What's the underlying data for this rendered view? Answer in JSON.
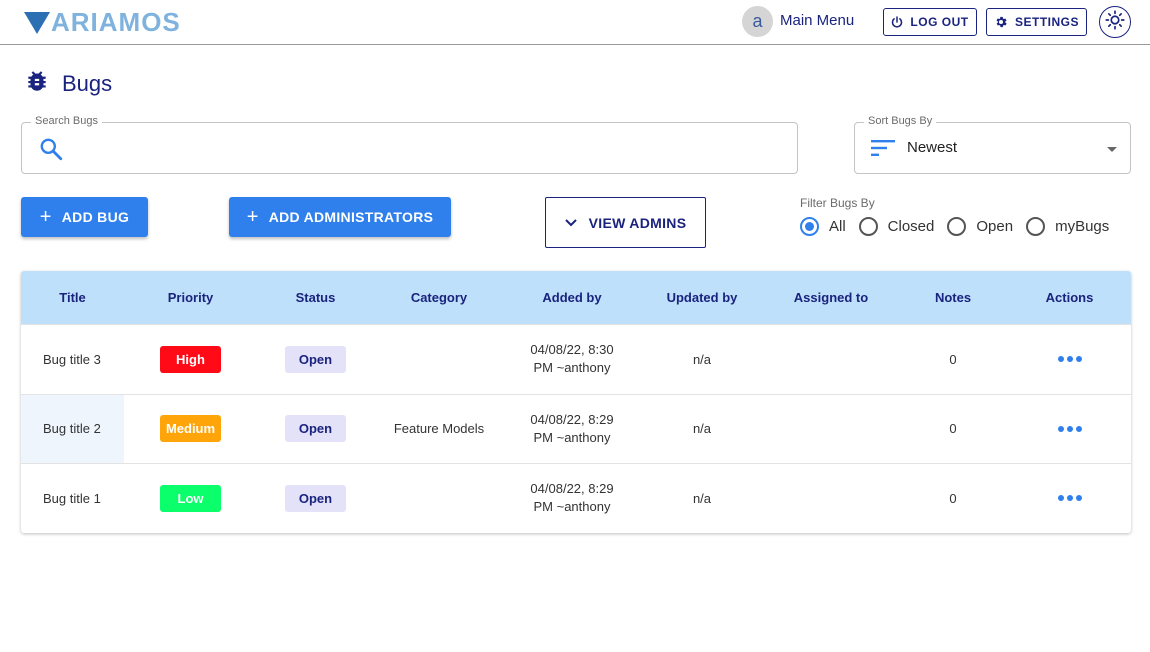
{
  "app": {
    "logo_text": "ARIAMOS",
    "logo_full": "VARIAMOS",
    "user_initial": "a",
    "main_menu": "Main Menu",
    "logout_label": "LOG OUT",
    "settings_label": "SETTINGS"
  },
  "page": {
    "title": "Bugs"
  },
  "search": {
    "label": "Search Bugs",
    "value": ""
  },
  "sort": {
    "label": "Sort Bugs By",
    "value": "Newest"
  },
  "actions": {
    "add_bug": "ADD BUG",
    "add_admins": "ADD ADMINISTRATORS",
    "view_admins": "VIEW ADMINS"
  },
  "filter": {
    "label": "Filter Bugs By",
    "options": [
      "All",
      "Closed",
      "Open",
      "myBugs"
    ],
    "selected": "All"
  },
  "table": {
    "headers": [
      "Title",
      "Priority",
      "Status",
      "Category",
      "Added by",
      "Updated by",
      "Assigned to",
      "Notes",
      "Actions"
    ],
    "rows": [
      {
        "title": "Bug title 3",
        "priority": "High",
        "status": "Open",
        "category": "",
        "added_date": "04/08/22, 8:30",
        "added_user": "PM ~anthony",
        "updated_by": "n/a",
        "assigned_to": "",
        "notes": "0"
      },
      {
        "title": "Bug title 2",
        "priority": "Medium",
        "status": "Open",
        "category": "Feature Models",
        "added_date": "04/08/22, 8:29",
        "added_user": "PM ~anthony",
        "updated_by": "n/a",
        "assigned_to": "",
        "notes": "0"
      },
      {
        "title": "Bug title 1",
        "priority": "Low",
        "status": "Open",
        "category": "",
        "added_date": "04/08/22, 8:29",
        "added_user": "PM ~anthony",
        "updated_by": "n/a",
        "assigned_to": "",
        "notes": "0"
      }
    ]
  },
  "colors": {
    "primary": "#2f80ed",
    "navy": "#1a237e",
    "header_bg": "#bfe0fb",
    "priority_high": "#ff0a16",
    "priority_medium": "#ffa50a",
    "priority_low": "#0aff6a"
  },
  "icons": {
    "logout": "power-icon",
    "settings": "gear-icon",
    "theme": "sun-icon",
    "title": "bug-icon",
    "search": "search-icon",
    "sort": "sort-icon",
    "view_admins": "chevron-down-icon",
    "actions": "more-horiz-icon"
  }
}
